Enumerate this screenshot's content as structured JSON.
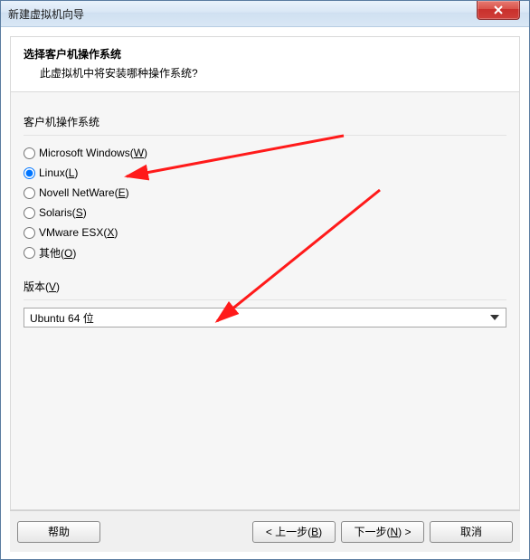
{
  "window": {
    "title": "新建虚拟机向导"
  },
  "header": {
    "title": "选择客户机操作系统",
    "subtitle": "此虚拟机中将安装哪种操作系统?"
  },
  "os_section": {
    "label": "客户机操作系统",
    "options": [
      {
        "label": "Microsoft Windows",
        "mnemonic": "W",
        "selected": false
      },
      {
        "label": "Linux",
        "mnemonic": "L",
        "selected": true
      },
      {
        "label": "Novell NetWare",
        "mnemonic": "E",
        "selected": false
      },
      {
        "label": "Solaris",
        "mnemonic": "S",
        "selected": false
      },
      {
        "label": "VMware ESX",
        "mnemonic": "X",
        "selected": false
      },
      {
        "label": "其他",
        "mnemonic": "O",
        "selected": false
      }
    ]
  },
  "version_section": {
    "label": "版本",
    "mnemonic": "V",
    "selected": "Ubuntu 64 位"
  },
  "footer": {
    "help": "帮助",
    "back": "< 上一步",
    "back_mnemonic": "B",
    "next": "下一步",
    "next_mnemonic": "N",
    "next_suffix": " >",
    "cancel": "取消"
  }
}
